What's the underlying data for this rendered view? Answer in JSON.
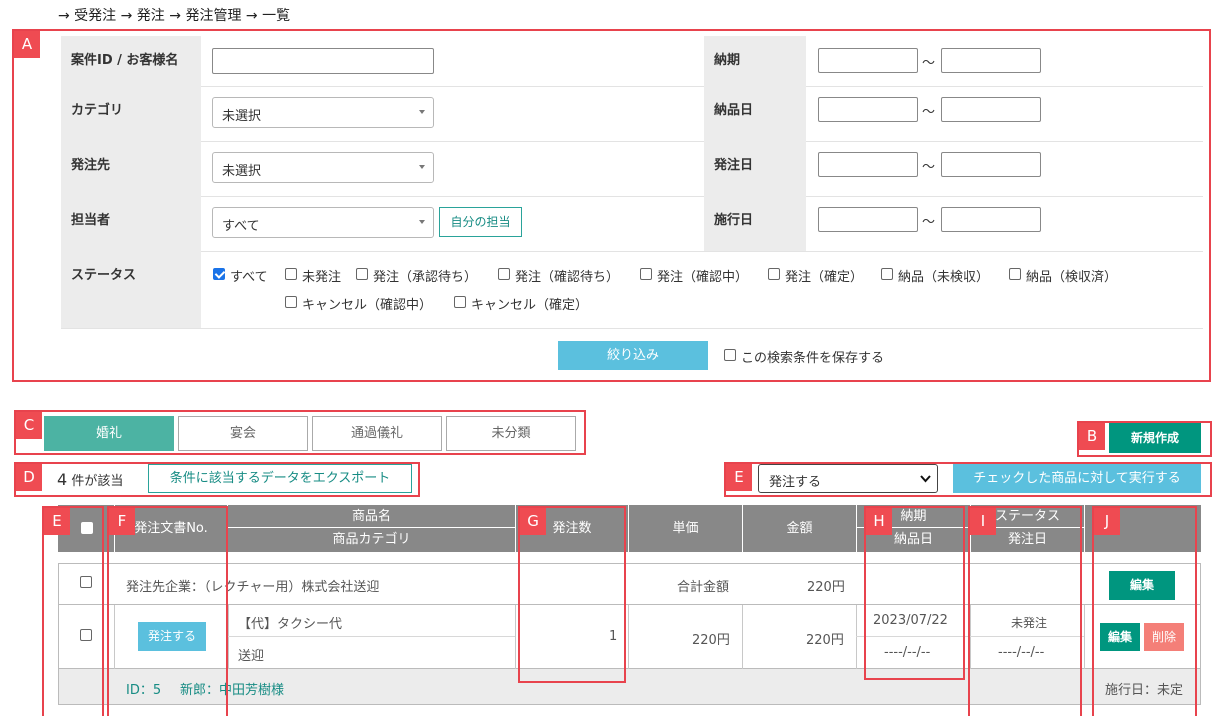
{
  "breadcrumb": "→ 受発注 → 発注 → 発注管理 → 一覧",
  "annotations": {
    "A": "A",
    "B": "B",
    "C": "C",
    "D": "D",
    "E": "E",
    "F": "F",
    "G": "G",
    "H": "H",
    "I": "I",
    "J": "J"
  },
  "filters": {
    "case_label": "案件ID / お客様名",
    "case_value": "",
    "category_label": "カテゴリ",
    "category_value": "未選択",
    "vendor_label": "発注先",
    "vendor_value": "未選択",
    "staff_label": "担当者",
    "staff_value": "すべて",
    "my_staff_button": "自分の担当",
    "deadline_label": "納期",
    "delivery_label": "納品日",
    "order_date_label": "発注日",
    "event_date_label": "施行日",
    "range_sep": "～",
    "status_label": "ステータス",
    "statuses": [
      "すべて",
      "未発注",
      "発注（承認待ち）",
      "発注（確認待ち）",
      "発注（確認中）",
      "発注（確定）",
      "納品（未検収）",
      "納品（検収済）",
      "キャンセル（確認中）",
      "キャンセル（確定）"
    ],
    "filter_button": "絞り込み",
    "save_condition": "この検索条件を保存する"
  },
  "tabs": [
    "婚礼",
    "宴会",
    "通過儀礼",
    "未分類"
  ],
  "new_button": "新規作成",
  "count": {
    "number": "4",
    "suffix": "件が該当"
  },
  "export_button": "条件に該当するデータをエクスポート",
  "bulk": {
    "action_value": "発注する",
    "execute_button": "チェックした商品に対して実行する"
  },
  "table": {
    "headers": {
      "order_no": "発注文書No.",
      "product_name": "商品名",
      "product_category": "商品カテゴリ",
      "quantity": "発注数",
      "unit_price": "単価",
      "amount": "金額",
      "deadline": "納期",
      "delivery": "納品日",
      "status": "ステータス",
      "order_date": "発注日"
    },
    "group": {
      "vendor": "発注先企業：（レクチャー用）株式会社送迎",
      "total_label": "合計金額",
      "total": "220円",
      "edit": "編集"
    },
    "row": {
      "order_button": "発注する",
      "product": "【代】タクシー代",
      "category": "送迎",
      "quantity": "1",
      "unit_price": "220円",
      "amount": "220円",
      "deadline": "2023/07/22",
      "delivery": "----/--/--",
      "status": "未発注",
      "order_date": "----/--/--",
      "edit": "編集",
      "delete": "削除"
    },
    "footer": {
      "id": "ID：5",
      "groom": "新郎：中田芳樹様",
      "event_date": "施行日：未定"
    }
  }
}
